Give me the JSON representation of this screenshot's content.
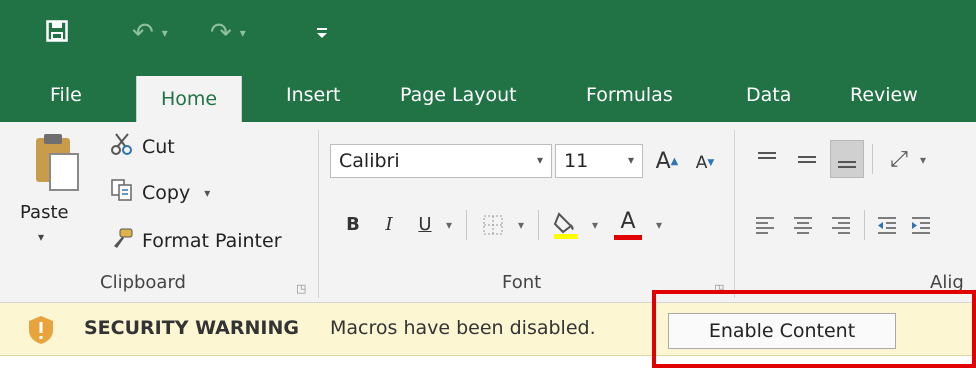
{
  "quick_access": {
    "save_icon": "save-icon",
    "undo_icon": "undo-icon",
    "redo_icon": "redo-icon",
    "customize_icon": "customize-qat-icon"
  },
  "tabs": [
    {
      "label": "File"
    },
    {
      "label": "Home",
      "active": true
    },
    {
      "label": "Insert"
    },
    {
      "label": "Page Layout"
    },
    {
      "label": "Formulas"
    },
    {
      "label": "Data"
    },
    {
      "label": "Review"
    }
  ],
  "clipboard": {
    "paste_label": "Paste",
    "cut_label": "Cut",
    "copy_label": "Copy",
    "format_painter_label": "Format Painter",
    "group_label": "Clipboard"
  },
  "font": {
    "font_name": "Calibri",
    "font_size": "11",
    "bold": "B",
    "italic": "I",
    "underline": "U",
    "font_color_glyph": "A",
    "grow_glyph": "A",
    "shrink_glyph": "A",
    "group_label": "Font",
    "highlight_color": "#ffff00",
    "font_color": "#e00000"
  },
  "alignment": {
    "group_label_partial": "Alig"
  },
  "security": {
    "title": "SECURITY WARNING",
    "message": "Macros have been disabled.",
    "button_label": "Enable Content"
  },
  "colors": {
    "brand_green": "#217346",
    "ribbon_bg": "#f3f3f3",
    "warning_bg": "#fdf6d3",
    "highlight_box": "#e00000"
  }
}
